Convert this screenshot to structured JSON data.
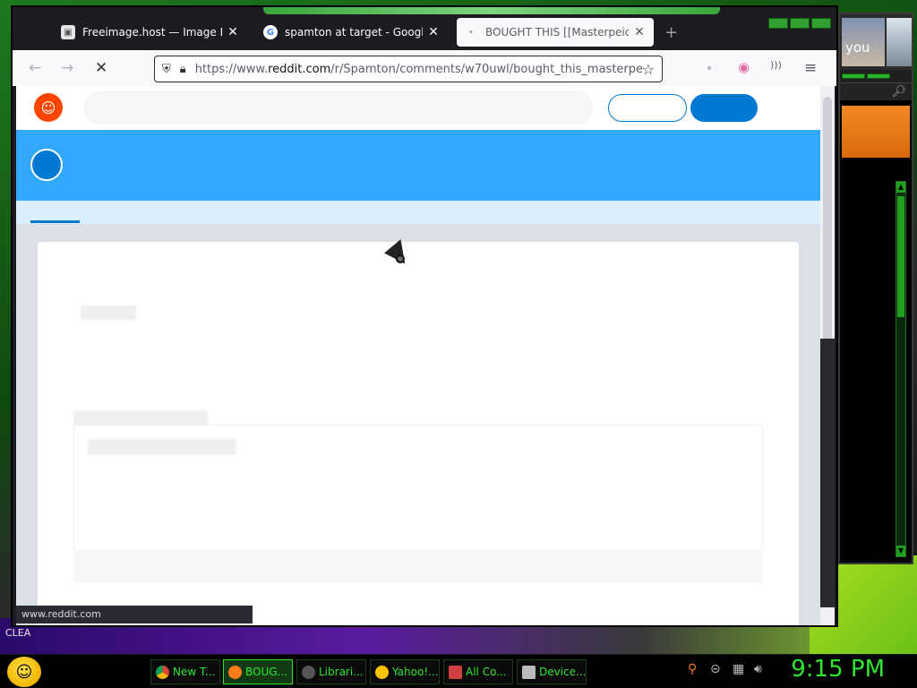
{
  "desktop": {
    "corner_label": "CLEA"
  },
  "side_panel": {
    "thumb_label": "you"
  },
  "browser": {
    "tabs": [
      {
        "title": "Freeimage.host — Image Hostin",
        "icon": "freeimage-icon",
        "active": false
      },
      {
        "title": "spamton at target - Google Sea",
        "icon": "google-icon",
        "active": false
      },
      {
        "title": "BOUGHT THIS [[Masterpeice]] a",
        "icon": "loading-dot-icon",
        "active": true
      }
    ],
    "new_tab_label": "+",
    "url_prefix": "https://www.",
    "url_domain": "reddit.com",
    "url_path": "/r/Spamton/comments/w70uwl/bought_this_masterpe",
    "status_url": "www.reddit.com"
  },
  "taskbar": {
    "items": [
      {
        "label": "New T...",
        "icon_color": "#e8e8e8",
        "active": false
      },
      {
        "label": "BOUG...",
        "icon_color": "#ff7a18",
        "active": true
      },
      {
        "label": "Librari...",
        "icon_color": "#555555",
        "active": false
      },
      {
        "label": "Yahoo!...",
        "icon_color": "#ffc400",
        "active": false
      },
      {
        "label": "All Co...",
        "icon_color": "#d04040",
        "active": false
      },
      {
        "label": "Device...",
        "icon_color": "#bbbbbb",
        "active": false
      }
    ],
    "clock": "9:15 PM"
  }
}
